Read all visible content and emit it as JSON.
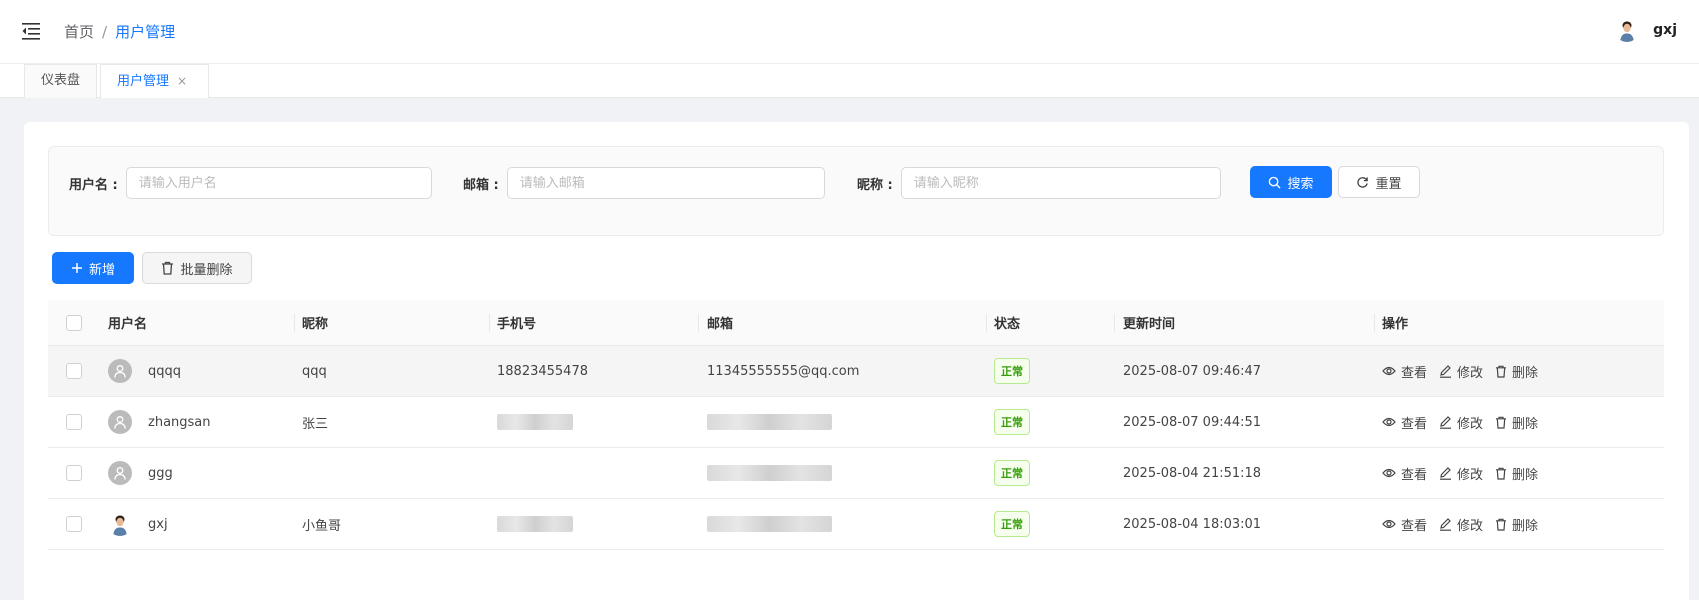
{
  "header": {
    "menu_icon": "menu-fold-icon",
    "breadcrumb": {
      "home": "首页",
      "separator": "/",
      "current": "用户管理"
    },
    "user": {
      "name": "gxj",
      "avatar_icon": "user-photo-avatar"
    }
  },
  "tabs": [
    {
      "label": "仪表盘",
      "active": false
    },
    {
      "label": "用户管理",
      "active": true,
      "close": "×"
    }
  ],
  "search": {
    "username": {
      "label": "用户名 :",
      "placeholder": "请输入用户名",
      "value": ""
    },
    "email": {
      "label": "邮箱 :",
      "placeholder": "请输入邮箱",
      "value": ""
    },
    "nickname": {
      "label": "昵称 :",
      "placeholder": "请输入昵称",
      "value": ""
    },
    "search_button": "搜索",
    "reset_button": "重置"
  },
  "toolbar": {
    "add_button": "新增",
    "batch_delete_button": "批量删除"
  },
  "table": {
    "columns": [
      "用户名",
      "昵称",
      "手机号",
      "邮箱",
      "状态",
      "更新时间",
      "操作"
    ],
    "actions": {
      "view": "查看",
      "edit": "修改",
      "delete": "删除"
    },
    "rows": [
      {
        "username": "qqqq",
        "nickname": "qqq",
        "phone": "18823455478",
        "email": "11345555555@qq.com",
        "status": "正常",
        "updated": "2025-08-07 09:46:47",
        "avatar": "default",
        "highlight": true
      },
      {
        "username": "zhangsan",
        "nickname": "张三",
        "phone": "",
        "email": "",
        "status": "正常",
        "updated": "2025-08-07 09:44:51",
        "avatar": "default",
        "highlight": false
      },
      {
        "username": "ggg",
        "nickname": "",
        "phone": "",
        "email": "",
        "status": "正常",
        "updated": "2025-08-04 21:51:18",
        "avatar": "default",
        "highlight": false
      },
      {
        "username": "gxj",
        "nickname": "小鱼哥",
        "phone": "",
        "email": "",
        "status": "正常",
        "updated": "2025-08-04 18:03:01",
        "avatar": "photo",
        "highlight": false
      }
    ]
  },
  "colors": {
    "primary": "#1677ff",
    "success": "#389e0d"
  }
}
